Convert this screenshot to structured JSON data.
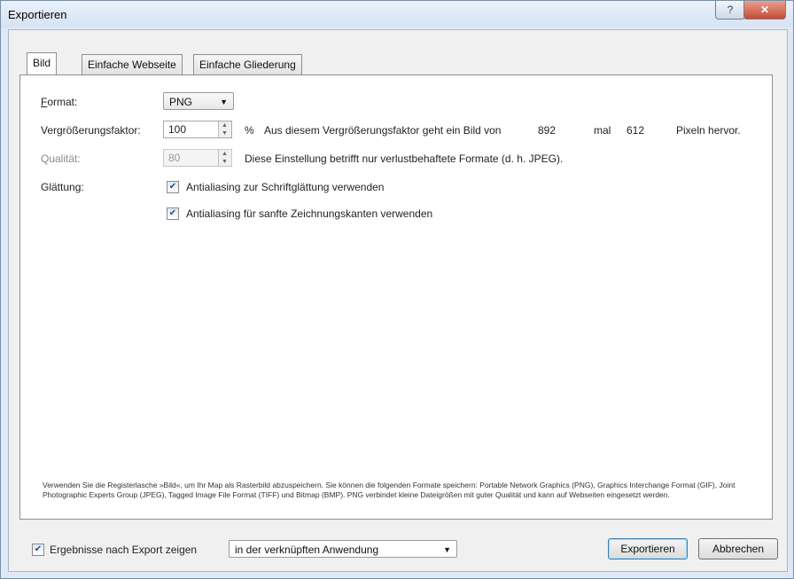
{
  "window": {
    "title": "Exportieren",
    "help_label": "?",
    "close_label": "✕"
  },
  "tabs": [
    {
      "label": "Bild"
    },
    {
      "label": "Einfache Webseite"
    },
    {
      "label": "Einfache Gliederung"
    }
  ],
  "format": {
    "label": "Format:",
    "value": "PNG"
  },
  "scale": {
    "label": "Vergrößerungsfaktor:",
    "value": "100",
    "unit": "%",
    "desc_prefix": "Aus diesem Vergrößerungsfaktor geht ein Bild von",
    "width": "892",
    "mal": "mal",
    "height": "612",
    "desc_suffix": "Pixeln hervor."
  },
  "quality": {
    "label": "Qualität:",
    "value": "80",
    "note": "Diese Einstellung betrifft nur verlustbehaftete Formate (d. h. JPEG)."
  },
  "smoothing": {
    "label": "Glättung:",
    "option_text": {
      "checked": true,
      "label": "Antialiasing zur Schriftglättung verwenden"
    },
    "option_edges": {
      "checked": true,
      "label": "Antialiasing für sanfte Zeichnungskanten verwenden"
    }
  },
  "info_text": "Verwenden Sie die Registerlasche »Bild«, um Ihr Map als Rasterbild abzuspeichern. Sie können die folgenden Formate speichern: Portable Network Graphics (PNG), Graphics Interchange Format (GIF), Joint Photographic Experts Group (JPEG), Tagged Image File Format (TIFF) und Bitmap (BMP). PNG verbindet kleine Dateigrößen mit guter Qualität und kann auf Webseiten eingesetzt werden.",
  "footer": {
    "show_results": {
      "checked": true,
      "label": "Ergebnisse nach Export zeigen"
    },
    "app_select": "in der verknüpften Anwendung",
    "export_label": "Exportieren",
    "cancel_label": "Abbrechen"
  }
}
